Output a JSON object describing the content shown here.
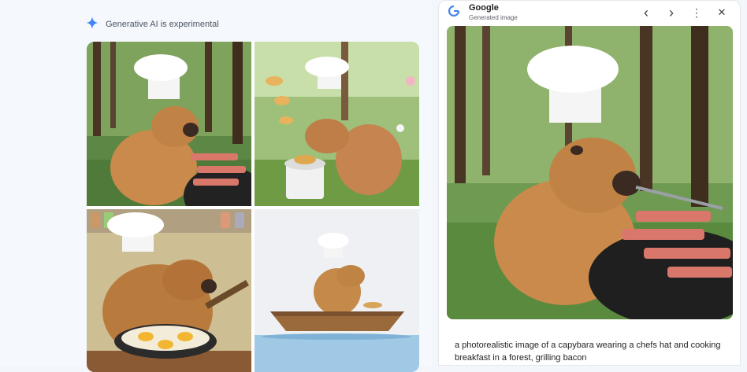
{
  "banner": {
    "icon": "gemini-sparkle-icon",
    "label": "Generative AI is experimental"
  },
  "grid": {
    "tiles": [
      {
        "name": "capybara-chef-grill-forest"
      },
      {
        "name": "capybara-chef-meadow-pancakes"
      },
      {
        "name": "capybara-chef-kitchen-frying-pan"
      },
      {
        "name": "capybara-chef-boat-watercolor"
      }
    ]
  },
  "panel": {
    "logo": "G",
    "title": "Google",
    "subtitle": "Generated image",
    "buttons": {
      "prev": "‹",
      "next": "›",
      "more": "⋮",
      "close": "✕"
    },
    "caption": "a photorealistic image of a capybara wearing a chefs hat and cooking breakfast in a forest, grilling bacon"
  },
  "colors": {
    "accent": "#1a73e8",
    "capybara": "#c98a4b",
    "forest": "#4f7a3a",
    "bacon": "#d9776b"
  }
}
